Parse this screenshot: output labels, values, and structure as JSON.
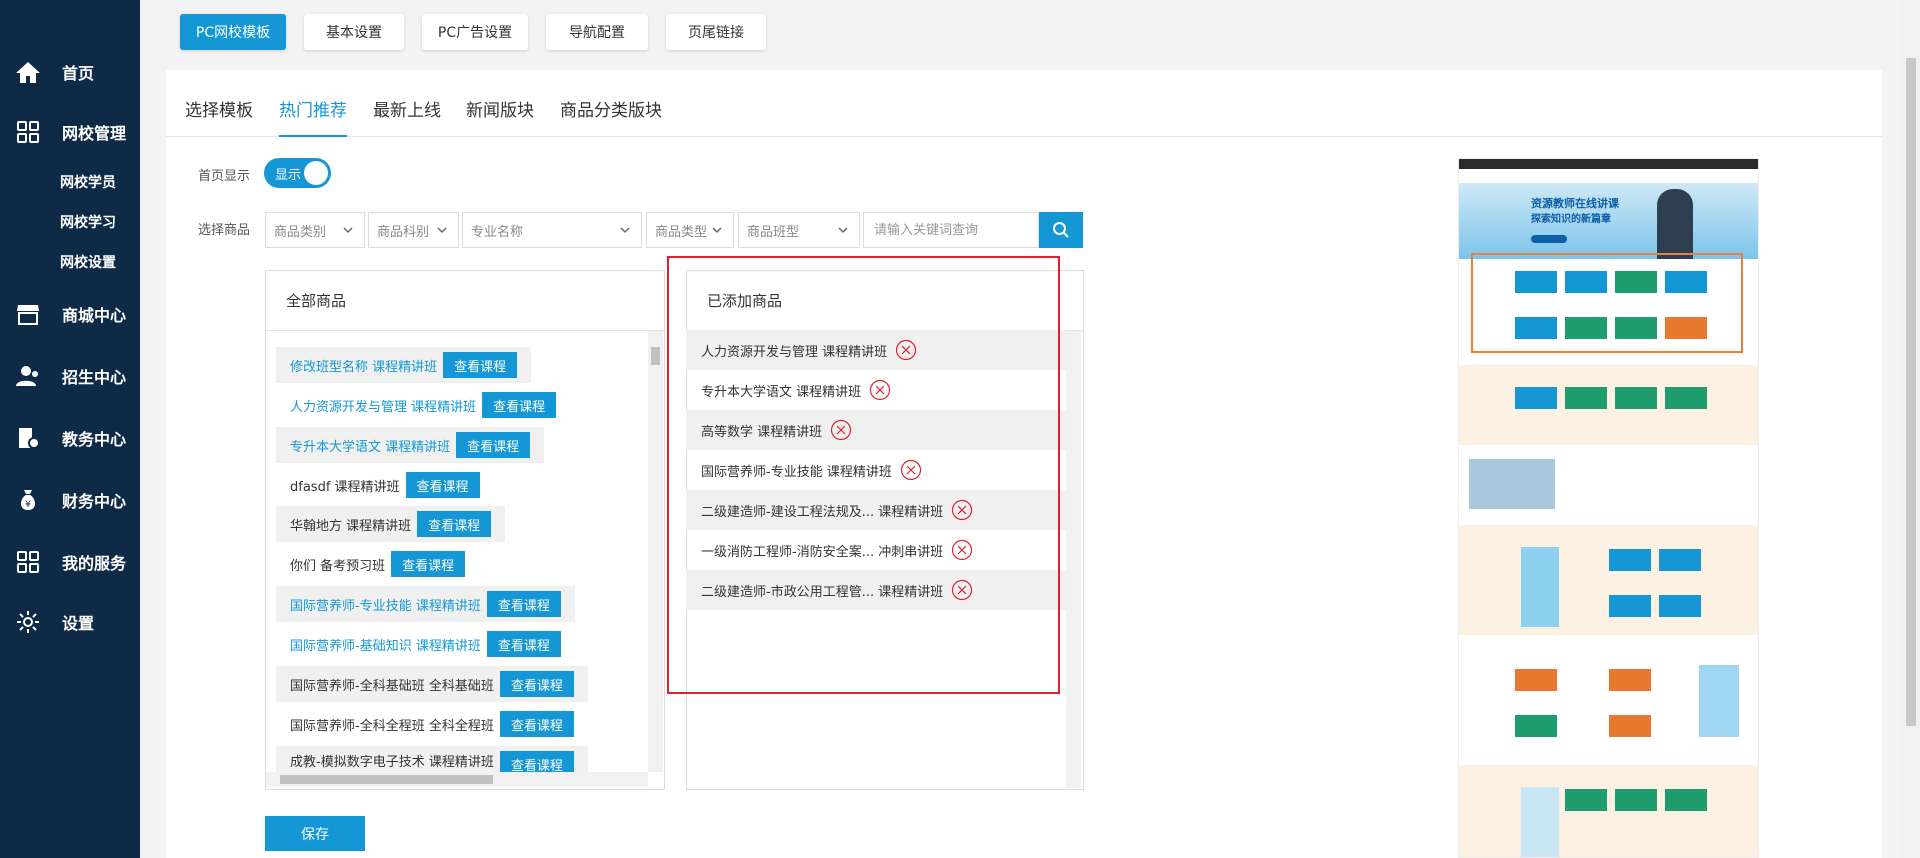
{
  "sidebar": {
    "items": [
      {
        "label": "首页",
        "icon": "home-icon"
      },
      {
        "label": "网校管理",
        "icon": "grid-icon"
      },
      {
        "label": "商城中心",
        "icon": "store-icon"
      },
      {
        "label": "招生中心",
        "icon": "users-icon"
      },
      {
        "label": "教务中心",
        "icon": "book-icon"
      },
      {
        "label": "财务中心",
        "icon": "moneybag-icon"
      },
      {
        "label": "我的服务",
        "icon": "grid-icon"
      },
      {
        "label": "设置",
        "icon": "gear-icon"
      }
    ],
    "sub_items": [
      "网校学员",
      "网校学习",
      "网校设置"
    ]
  },
  "top_tabs": [
    "PC网校模板",
    "基本设置",
    "PC广告设置",
    "导航配置",
    "页尾链接"
  ],
  "sub_tabs": [
    "选择模板",
    "热门推荐",
    "最新上线",
    "新闻版块",
    "商品分类版块"
  ],
  "form": {
    "home_display_label": "首页显示",
    "toggle_label": "显示",
    "select_goods_label": "选择商品",
    "filters": [
      "商品类别",
      "商品科别",
      "专业名称",
      "商品类型",
      "商品班型"
    ],
    "search_placeholder": "请输入关键词查询"
  },
  "all_goods": {
    "title": "全部商品",
    "view_label": "查看课程",
    "rows": [
      "修改班型名称 课程精讲班",
      "人力资源开发与管理 课程精讲班",
      "专升本大学语文 课程精讲班",
      "dfasdf 课程精讲班",
      "华翰地方 课程精讲班",
      "你们 备考预习班",
      "国际营养师-专业技能 课程精讲班",
      "国际营养师-基础知识 课程精讲班",
      "国际营养师-全科基础班 全科基础班",
      "国际营养师-全科全程班 全科全程班",
      "成教-模拟数字电子技术 课程精讲班"
    ]
  },
  "added_goods": {
    "title": "已添加商品",
    "rows": [
      "人力资源开发与管理 课程精讲班",
      "专升本大学语文 课程精讲班",
      "高等数学 课程精讲班",
      "国际营养师-专业技能 课程精讲班",
      "二级建造师-建设工程法规及... 课程精讲班",
      "一级消防工程师-消防安全案... 冲刺串讲班",
      "二级建造师-市政公用工程管... 课程精讲班"
    ]
  },
  "save_label": "保存",
  "preview": {
    "hero_line1": "资源教师在线讲课",
    "hero_line2": "探索知识的新篇章"
  },
  "colors": {
    "primary": "#1597d5",
    "sidebar": "#0e2a47",
    "highlight": "#e0202c"
  }
}
